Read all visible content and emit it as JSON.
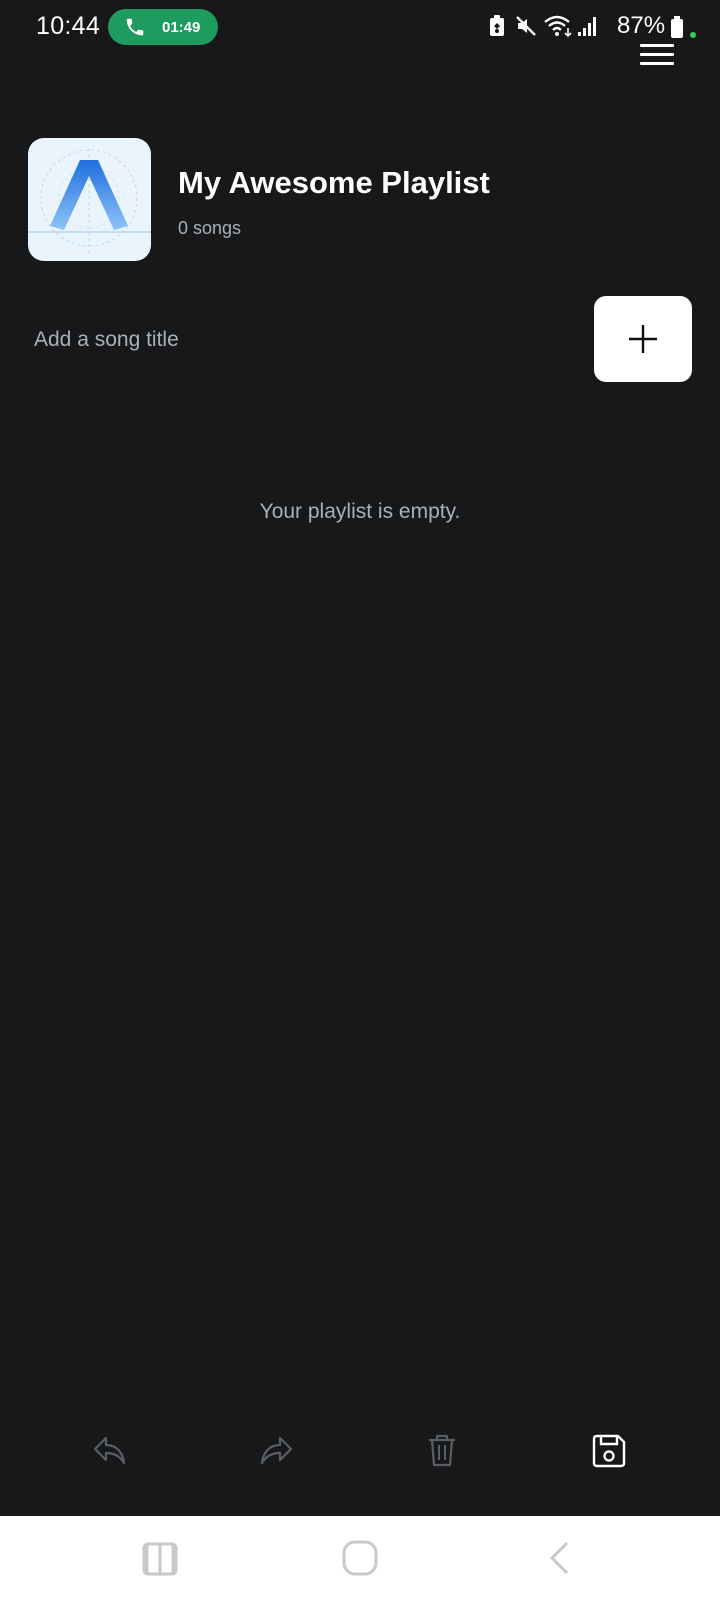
{
  "status_bar": {
    "time": "10:44",
    "call_duration": "01:49",
    "battery_percent": "87%",
    "icons": [
      "phone-icon",
      "battery-saver-icon",
      "mute-icon",
      "wifi-icon",
      "signal-icon",
      "battery-icon"
    ]
  },
  "header": {
    "title": "My Awesome Playlist",
    "song_count": "0 songs",
    "cover_icon": "app-logo"
  },
  "add_song": {
    "placeholder": "Add a song title",
    "value": "",
    "button_icon": "plus-icon"
  },
  "playlist": {
    "empty_message": "Your playlist is empty.",
    "songs": []
  },
  "toolbar": {
    "icons": [
      "undo-icon",
      "redo-icon",
      "delete-icon",
      "save-icon"
    ]
  },
  "navbar": {
    "icons": [
      "recent-apps-icon",
      "home-icon",
      "back-icon"
    ]
  },
  "colors": {
    "background": "#171819",
    "call_chip": "#1e9b5e",
    "secondary_text": "#aab0b6",
    "disabled_icon": "#5a5e62"
  }
}
